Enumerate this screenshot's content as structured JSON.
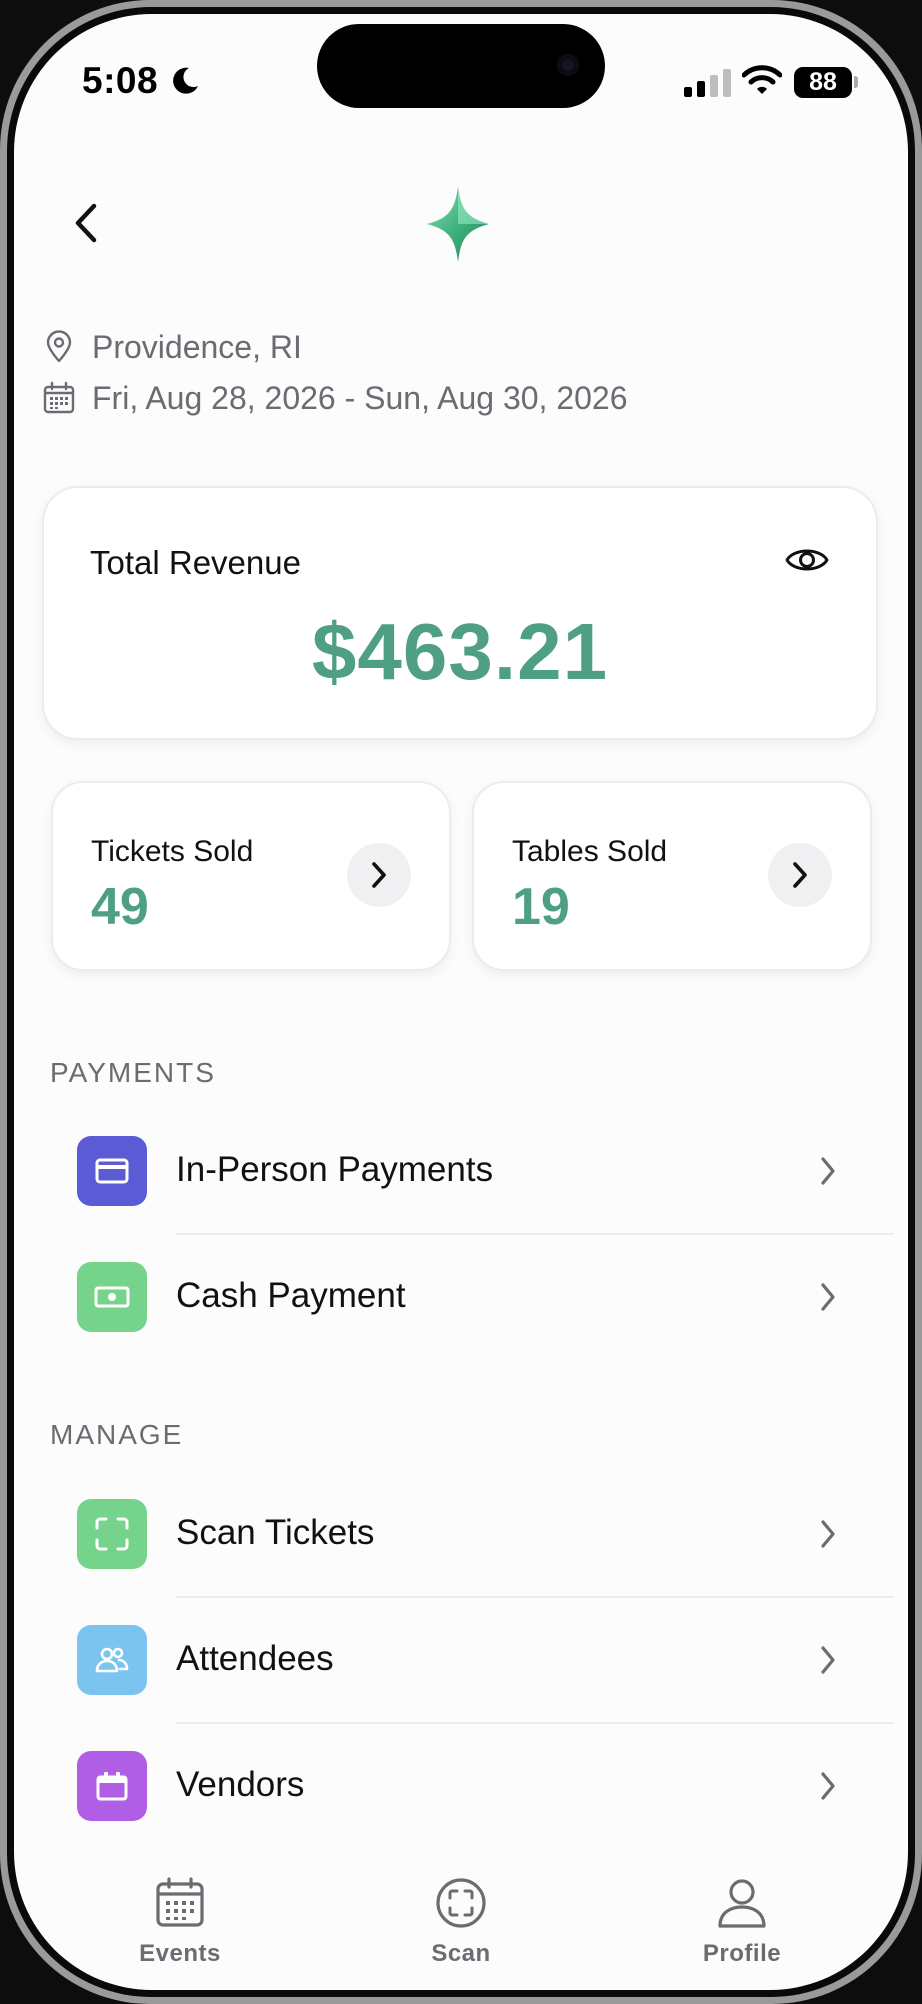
{
  "status_bar": {
    "time": "5:08",
    "battery": "88"
  },
  "event": {
    "location": "Providence, RI",
    "dates": "Fri, Aug 28, 2026 - Sun, Aug 30, 2026"
  },
  "revenue": {
    "label": "Total Revenue",
    "value": "$463.21"
  },
  "stats": [
    {
      "label": "Tickets Sold",
      "value": "49"
    },
    {
      "label": "Tables Sold",
      "value": "19"
    }
  ],
  "payments": {
    "header": "PAYMENTS",
    "items": [
      {
        "label": "In-Person Payments",
        "icon": "card-icon",
        "color": "#5b5bd6"
      },
      {
        "label": "Cash Payment",
        "icon": "cash-icon",
        "color": "#76d38b"
      }
    ]
  },
  "manage": {
    "header": "MANAGE",
    "items": [
      {
        "label": "Scan Tickets",
        "icon": "scan-icon",
        "color": "#76d38b"
      },
      {
        "label": "Attendees",
        "icon": "people-icon",
        "color": "#7cc4f0"
      },
      {
        "label": "Vendors",
        "icon": "vendor-icon",
        "color": "#b15ee6"
      }
    ]
  },
  "tabs": [
    {
      "label": "Events",
      "icon": "calendar-icon"
    },
    {
      "label": "Scan",
      "icon": "scan-icon"
    },
    {
      "label": "Profile",
      "icon": "person-icon"
    }
  ],
  "colors": {
    "accent": "#4e9f84",
    "muted_text": "#6b6b72"
  }
}
